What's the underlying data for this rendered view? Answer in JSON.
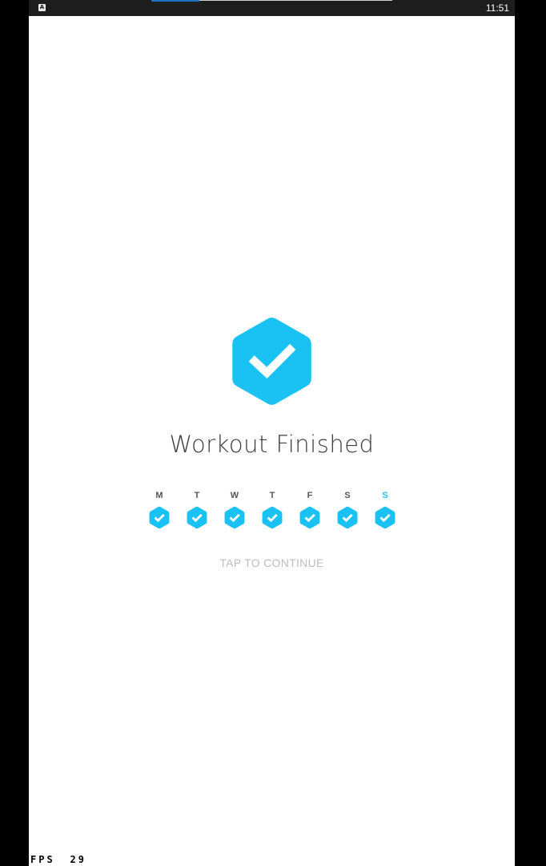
{
  "status_bar": {
    "app_icon": "A",
    "time": "11:51"
  },
  "workout": {
    "title": "Workout Finished",
    "badge_icon": "hexagon-check-icon",
    "accent_color": "#1ac2f4",
    "tap_label": "TAP TO CONTINUE"
  },
  "week": {
    "days": [
      {
        "letter": "M",
        "completed": true,
        "today": false
      },
      {
        "letter": "T",
        "completed": true,
        "today": false
      },
      {
        "letter": "W",
        "completed": true,
        "today": false
      },
      {
        "letter": "T",
        "completed": true,
        "today": false
      },
      {
        "letter": "F",
        "completed": true,
        "today": false
      },
      {
        "letter": "S",
        "completed": true,
        "today": false
      },
      {
        "letter": "S",
        "completed": true,
        "today": true
      }
    ]
  },
  "debug": {
    "fps_label": "FPS",
    "fps_value": "29"
  }
}
